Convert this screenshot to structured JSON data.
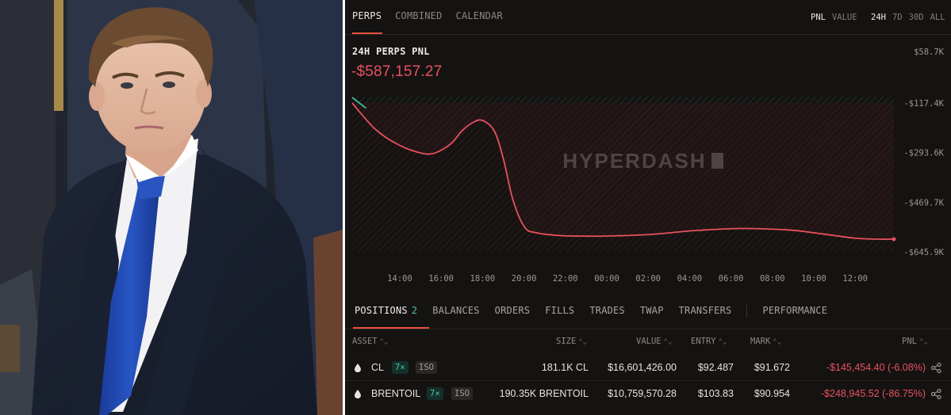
{
  "top_tabs": [
    {
      "label": "PERPS",
      "active": true
    },
    {
      "label": "COMBINED",
      "active": false
    },
    {
      "label": "CALENDAR",
      "active": false
    }
  ],
  "metric_toggle": [
    {
      "label": "PNL",
      "active": true
    },
    {
      "label": "VALUE",
      "active": false
    }
  ],
  "range_toggle": [
    {
      "label": "24H",
      "active": true
    },
    {
      "label": "7D",
      "active": false
    },
    {
      "label": "30D",
      "active": false
    },
    {
      "label": "ALL",
      "active": false
    }
  ],
  "pnl_summary": {
    "label": "24H PERPS PNL",
    "value": "-$587,157.27"
  },
  "watermark": "HYPERDASH",
  "chart_data": {
    "type": "area",
    "x_ticks": [
      "14:00",
      "16:00",
      "18:00",
      "20:00",
      "22:00",
      "00:00",
      "02:00",
      "04:00",
      "06:00",
      "08:00",
      "10:00",
      "12:00"
    ],
    "y_ticks": [
      "$58.7K",
      "-$117.4K",
      "-$293.6K",
      "-$469.7K",
      "-$645.9K"
    ],
    "ylim": [
      -645.9,
      58.7
    ],
    "y_unit": "K USD",
    "series": [
      {
        "x": [
          13.0,
          14.0,
          15.0,
          16.0,
          16.6,
          17.3,
          17.8,
          18.3,
          18.7,
          19.2,
          19.6,
          20.0,
          20.5,
          21.0,
          22.0,
          23.0,
          24.0,
          26.0,
          28.0,
          30.0,
          32.0,
          33.0,
          34.0,
          35.0,
          36.0,
          36.6
        ],
        "y": [
          -117.4,
          -210,
          -265,
          -295,
          -295,
          -262,
          -215,
          -185,
          -180,
          -218,
          -320,
          -460,
          -557,
          -578,
          -588,
          -590,
          -590,
          -584,
          -570,
          -563,
          -568,
          -577,
          -588,
          -598,
          -601,
          -601
        ]
      }
    ],
    "colors": {
      "line": "#e8515d",
      "start_segment": "#3fbf9b",
      "area_fill": "#d64455"
    }
  },
  "position_tabs": [
    {
      "label": "POSITIONS",
      "count": "2",
      "active": true
    },
    {
      "label": "BALANCES"
    },
    {
      "label": "ORDERS"
    },
    {
      "label": "FILLS"
    },
    {
      "label": "TRADES"
    },
    {
      "label": "TWAP"
    },
    {
      "label": "TRANSFERS"
    },
    {
      "label": "PERFORMANCE"
    }
  ],
  "table": {
    "columns": [
      "ASSET",
      "SIZE",
      "VALUE",
      "ENTRY",
      "MARK",
      "PNL"
    ],
    "rows": [
      {
        "asset": "CL",
        "leverage": "7×",
        "margin": "ISO",
        "size": "181.1K CL",
        "value": "$16,601,426.00",
        "entry": "$92.487",
        "mark": "$91.672",
        "pnl": "-$145,454.40 (-6.08%)"
      },
      {
        "asset": "BRENTOIL",
        "leverage": "7×",
        "margin": "ISO",
        "size": "190.35K BRENTOIL",
        "value": "$10,759,570.28",
        "entry": "$103.83",
        "mark": "$90.954",
        "pnl": "-$248,945.52 (-86.75%)"
      }
    ]
  },
  "colors": {
    "accent": "#e8503e",
    "negative": "#e8515d",
    "positive": "#45c4a7",
    "background": "#151312"
  }
}
